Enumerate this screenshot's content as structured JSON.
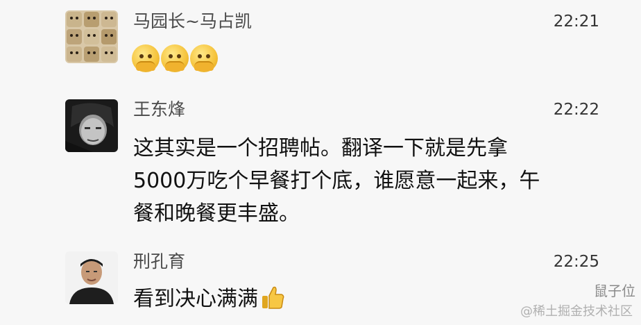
{
  "messages": [
    {
      "sender": "马园长~马占凯",
      "time": "22:21",
      "text": "",
      "emoji": [
        "facepalm-emoji",
        "facepalm-emoji",
        "facepalm-emoji"
      ]
    },
    {
      "sender": "王东烽",
      "time": "22:22",
      "lines": [
        "这其实是一个招聘帖。翻译一下就是先拿",
        "5000万吃个早餐打个底，谁愿意一起来，午",
        "餐和晚餐更丰盛。"
      ]
    },
    {
      "sender": "刑孔育",
      "time": "22:25",
      "text": "看到决心满满",
      "emoji": [
        "thumbs-up-emoji"
      ]
    }
  ],
  "watermarks": {
    "primary": "@稀土掘金技术社区",
    "secondary": "鼠子位"
  }
}
